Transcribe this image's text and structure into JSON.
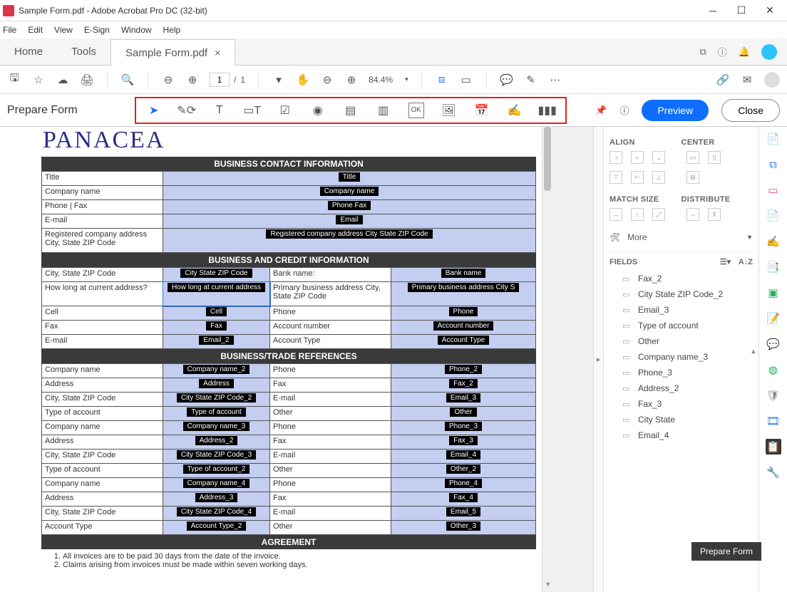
{
  "window": {
    "title": "Sample Form.pdf - Adobe Acrobat Pro DC (32-bit)"
  },
  "menu": {
    "file": "File",
    "edit": "Edit",
    "view": "View",
    "esign": "E-Sign",
    "window": "Window",
    "help": "Help"
  },
  "tabs": {
    "home": "Home",
    "tools": "Tools",
    "doc": "Sample Form.pdf"
  },
  "toolbar": {
    "page_current": "1",
    "page_total": "1",
    "zoom": "84.4%"
  },
  "formbar": {
    "title": "Prepare Form",
    "preview": "Preview",
    "close": "Close"
  },
  "doc": {
    "brand": "PANACEA",
    "s1": {
      "title": "BUSINESS CONTACT INFORMATION",
      "rows": [
        {
          "label": "Title",
          "field": "Title"
        },
        {
          "label": "Company name",
          "field": "Company name"
        },
        {
          "label": "Phone | Fax",
          "field": "Phone  Fax"
        },
        {
          "label": "E-mail",
          "field": "Email"
        },
        {
          "label": "Registered company address City, State ZIP Code",
          "field": "Registered company address City State ZIP Code"
        }
      ]
    },
    "s2": {
      "title": "BUSINESS AND CREDIT INFORMATION",
      "row1": {
        "l1": "City, State ZIP Code",
        "f1": "City State ZIP Code",
        "l2": "Bank name:",
        "f2": "Bank name"
      },
      "row2": {
        "l1": "How long at current address?",
        "f1": "How long at current address",
        "l2": "Primary business address City, State ZIP Code",
        "f2": "Primary business address City S"
      },
      "row3": {
        "l1": "Cell",
        "f1": "Cell",
        "l2": "Phone",
        "f2": "Phone"
      },
      "row4": {
        "l1": "Fax",
        "f1": "Fax",
        "l2": "Account number",
        "f2": "Account number"
      },
      "row5": {
        "l1": "E-mail",
        "f1": "Email_2",
        "l2": "Account Type",
        "f2": "Account Type"
      }
    },
    "s3": {
      "title": "BUSINESS/TRADE REFERENCES",
      "rows": [
        {
          "l1": "Company name",
          "f1": "Company name_2",
          "l2": "Phone",
          "f2": "Phone_2"
        },
        {
          "l1": "Address",
          "f1": "Address",
          "l2": "Fax",
          "f2": "Fax_2"
        },
        {
          "l1": "City, State ZIP Code",
          "f1": "City State ZIP Code_2",
          "l2": "E-mail",
          "f2": "Email_3"
        },
        {
          "l1": "Type of account",
          "f1": "Type of account",
          "l2": "Other",
          "f2": "Other"
        },
        {
          "l1": "Company name",
          "f1": "Company name_3",
          "l2": "Phone",
          "f2": "Phone_3"
        },
        {
          "l1": "Address",
          "f1": "Address_2",
          "l2": "Fax",
          "f2": "Fax_3"
        },
        {
          "l1": "City, State ZIP Code",
          "f1": "City State ZIP Code_3",
          "l2": "E-mail",
          "f2": "Email_4"
        },
        {
          "l1": "Type of account",
          "f1": "Type of account_2",
          "l2": "Other",
          "f2": "Other_2"
        },
        {
          "l1": "Company name",
          "f1": "Company name_4",
          "l2": "Phone",
          "f2": "Phone_4"
        },
        {
          "l1": "Address",
          "f1": "Address_3",
          "l2": "Fax",
          "f2": "Fax_4"
        },
        {
          "l1": "City, State ZIP Code",
          "f1": "City State ZIP Code_4",
          "l2": "E-mail",
          "f2": "Email_5"
        },
        {
          "l1": "Account Type",
          "f1": "Account Type_2",
          "l2": "Other",
          "f2": "Other_3"
        }
      ]
    },
    "s4": {
      "title": "AGREEMENT",
      "li1": "All invoices are to be paid 30 days from the date of the invoice.",
      "li2": "Claims arising from invoices must be made within seven working days."
    }
  },
  "panel": {
    "align": "ALIGN",
    "center": "CENTER",
    "match": "MATCH SIZE",
    "dist": "DISTRIBUTE",
    "more": "More",
    "fields": "FIELDS",
    "list": [
      "Fax_2",
      "City State ZIP Code_2",
      "Email_3",
      "Type of account",
      "Other",
      "Company name_3",
      "Phone_3",
      "Address_2",
      "Fax_3",
      "City State",
      "Email_4"
    ]
  },
  "tooltip": "Prepare Form"
}
